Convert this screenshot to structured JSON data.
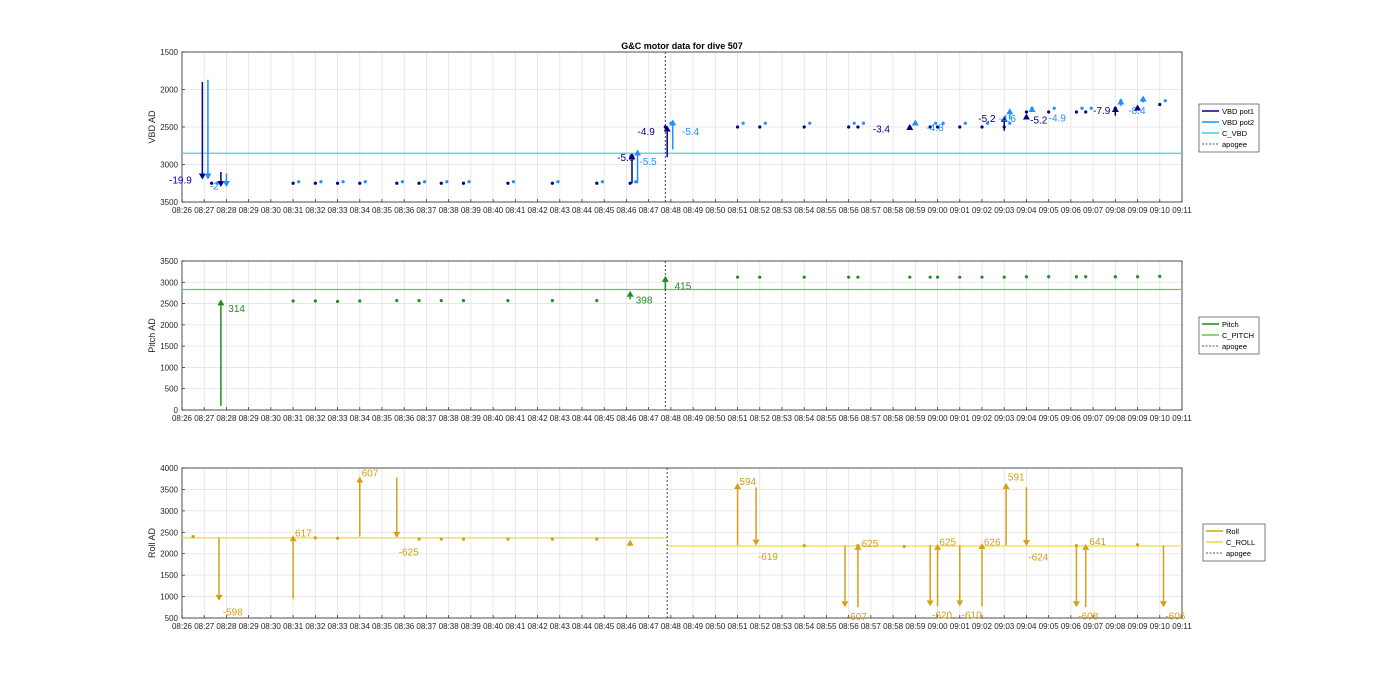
{
  "chart_data": [
    {
      "type": "scatter",
      "title": "G&C motor data for dive 507",
      "ylabel": "VBD AD",
      "y_reversed": true,
      "ylim": [
        1500,
        3500
      ],
      "yticks": [
        1500,
        2000,
        2500,
        3000,
        3500
      ],
      "xlim": [
        "08:26",
        "09:11"
      ],
      "grid": true,
      "legend": "right",
      "apogee": "08:47:45",
      "hlines": [
        {
          "name": "C_VBD",
          "y": 2850,
          "color": "#3cd6d6"
        }
      ],
      "series": [
        {
          "name": "VBD pot1",
          "color": "#00008b",
          "x": [
            "08:27:20",
            "08:31:00",
            "08:32:00",
            "08:33:00",
            "08:34:00",
            "08:35:40",
            "08:36:40",
            "08:37:40",
            "08:38:40",
            "08:40:40",
            "08:42:40",
            "08:44:40",
            "08:46:10",
            "08:47:45",
            "08:51:00",
            "08:52:00",
            "08:54:00",
            "08:56:00",
            "08:56:25",
            "08:58:45",
            "08:59:40",
            "09:00:00",
            "09:01:00",
            "09:02:00",
            "09:03:00",
            "09:04:00",
            "09:05:00",
            "09:06:15",
            "09:06:40",
            "09:08:00",
            "09:09:00",
            "09:10:00"
          ],
          "values": [
            3250,
            3250,
            3250,
            3250,
            3250,
            3250,
            3250,
            3250,
            3250,
            3250,
            3250,
            3250,
            3250,
            2500,
            2500,
            2500,
            2500,
            2500,
            2500,
            2500,
            2500,
            2500,
            2500,
            2500,
            2500,
            2300,
            2300,
            2300,
            2300,
            2250,
            2250,
            2200
          ]
        },
        {
          "name": "VBD pot2",
          "color": "#1e90ff",
          "x": [
            "08:27:35",
            "08:31:15",
            "08:32:15",
            "08:33:15",
            "08:34:15",
            "08:35:55",
            "08:36:55",
            "08:37:55",
            "08:38:55",
            "08:40:55",
            "08:42:55",
            "08:44:55",
            "08:46:25",
            "08:48:00",
            "08:51:15",
            "08:52:15",
            "08:54:15",
            "08:56:15",
            "08:56:40",
            "08:59:00",
            "08:59:55",
            "09:00:15",
            "09:01:15",
            "09:02:15",
            "09:03:15",
            "09:04:15",
            "09:05:15",
            "09:06:30",
            "09:06:55",
            "09:08:15",
            "09:09:15",
            "09:10:15"
          ],
          "values": [
            3250,
            3230,
            3230,
            3230,
            3230,
            3230,
            3230,
            3230,
            3230,
            3230,
            3230,
            3230,
            3230,
            2450,
            2450,
            2450,
            2450,
            2450,
            2450,
            2450,
            2450,
            2450,
            2450,
            2450,
            2450,
            2250,
            2250,
            2250,
            2250,
            2150,
            2150,
            2150
          ]
        },
        {
          "name": "C_VBD",
          "color": "#3cd6d6"
        },
        {
          "name": "apogee",
          "color": "#555555"
        }
      ],
      "arrows": [
        {
          "x": "08:26:55",
          "from": 1900,
          "to": 3200,
          "color": "#00008b",
          "label": "-19.9",
          "lx": "08:25:25",
          "ly": 3200
        },
        {
          "x": "08:27:10",
          "from": 1870,
          "to": 3200,
          "color": "#1e90ff",
          "label": "-2",
          "lx": "08:27:15",
          "ly": 3280
        },
        {
          "x": "08:27:45",
          "from": 3100,
          "to": 3300,
          "color": "#00008b"
        },
        {
          "x": "08:28:00",
          "from": 3120,
          "to": 3300,
          "color": "#1e90ff"
        },
        {
          "x": "08:46:15",
          "from": 3250,
          "to": 2850,
          "color": "#00008b",
          "label": "-5.0",
          "lx": "08:45:35",
          "ly": 2900
        },
        {
          "x": "08:46:30",
          "from": 3250,
          "to": 2800,
          "color": "#1e90ff",
          "label": "-5.5",
          "lx": "08:46:35",
          "ly": 2950
        },
        {
          "x": "08:47:50",
          "from": 2900,
          "to": 2480,
          "color": "#00008b",
          "label": "-4.9",
          "lx": "08:46:30",
          "ly": 2550
        },
        {
          "x": "08:48:05",
          "from": 2800,
          "to": 2400,
          "color": "#1e90ff",
          "label": "-5.4",
          "lx": "08:48:30",
          "ly": 2550
        },
        {
          "x": "08:58:45",
          "from": 2520,
          "to": 2460,
          "color": "#00008b",
          "label": "-3.4",
          "lx": "08:57:05",
          "ly": 2520
        },
        {
          "x": "08:59:00",
          "from": 2460,
          "to": 2400,
          "color": "#1e90ff",
          "label": "-4.8",
          "lx": "08:59:30",
          "ly": 2500
        },
        {
          "x": "09:03:00",
          "from": 2550,
          "to": 2350,
          "color": "#00008b",
          "label": "-5.2",
          "lx": "09:01:50",
          "ly": 2380
        },
        {
          "x": "09:03:15",
          "from": 2400,
          "to": 2250,
          "color": "#1e90ff",
          "label": "-4.6",
          "lx": "09:02:45",
          "ly": 2380
        },
        {
          "x": "09:04:00",
          "from": 2400,
          "to": 2320,
          "color": "#00008b",
          "label": "-5.2",
          "lx": "09:04:10",
          "ly": 2400
        },
        {
          "x": "09:04:15",
          "from": 2300,
          "to": 2220,
          "color": "#1e90ff",
          "label": "-4.9",
          "lx": "09:05:00",
          "ly": 2370
        },
        {
          "x": "09:08:00",
          "from": 2350,
          "to": 2220,
          "color": "#00008b",
          "label": "-7.9",
          "lx": "09:07:00",
          "ly": 2270
        },
        {
          "x": "09:08:15",
          "from": 2220,
          "to": 2120,
          "color": "#1e90ff",
          "label": "-8.4",
          "lx": "09:08:35",
          "ly": 2270
        },
        {
          "x": "09:09:00",
          "from": 2270,
          "to": 2200,
          "color": "#00008b"
        },
        {
          "x": "09:09:15",
          "from": 2170,
          "to": 2080,
          "color": "#1e90ff"
        }
      ]
    },
    {
      "type": "scatter",
      "ylabel": "Pitch AD",
      "ylim": [
        0,
        3500
      ],
      "yticks": [
        0,
        500,
        1000,
        1500,
        2000,
        2500,
        3000,
        3500
      ],
      "xlim": [
        "08:26",
        "09:11"
      ],
      "grid": true,
      "legend": "right",
      "apogee": "08:47:45",
      "hlines": [
        {
          "name": "C_PITCH",
          "y": 2830,
          "color": "#66cc44"
        }
      ],
      "series": [
        {
          "name": "Pitch",
          "color": "#228b22",
          "x": [
            "08:31:00",
            "08:32:00",
            "08:33:00",
            "08:34:00",
            "08:35:40",
            "08:36:40",
            "08:37:40",
            "08:38:40",
            "08:40:40",
            "08:42:40",
            "08:44:40",
            "08:51:00",
            "08:52:00",
            "08:54:00",
            "08:56:00",
            "08:56:25",
            "08:58:45",
            "08:59:40",
            "09:00:00",
            "09:01:00",
            "09:02:00",
            "09:03:00",
            "09:04:00",
            "09:05:00",
            "09:06:15",
            "09:06:40",
            "09:08:00",
            "09:09:00",
            "09:10:00"
          ],
          "values": [
            2560,
            2560,
            2550,
            2560,
            2570,
            2570,
            2570,
            2570,
            2570,
            2570,
            2570,
            3120,
            3120,
            3120,
            3120,
            3120,
            3120,
            3120,
            3120,
            3120,
            3120,
            3120,
            3130,
            3130,
            3130,
            3130,
            3130,
            3130,
            3140
          ]
        },
        {
          "name": "C_PITCH",
          "color": "#66cc44"
        },
        {
          "name": "apogee",
          "color": "#555555"
        }
      ],
      "arrows": [
        {
          "x": "08:27:45",
          "from": 100,
          "to": 2600,
          "color": "#228b22",
          "label": "314",
          "lx": "08:28:05",
          "ly": 2400
        },
        {
          "x": "08:46:10",
          "from": 2600,
          "to": 2800,
          "color": "#228b22",
          "label": "398",
          "lx": "08:46:25",
          "ly": 2600
        },
        {
          "x": "08:47:45",
          "from": 2800,
          "to": 3150,
          "color": "#228b22",
          "label": "415",
          "lx": "08:48:10",
          "ly": 2920
        }
      ]
    },
    {
      "type": "scatter",
      "ylabel": "Roll AD",
      "ylim": [
        500,
        4000
      ],
      "yticks": [
        500,
        1000,
        1500,
        2000,
        2500,
        3000,
        3500,
        4000
      ],
      "xlim": [
        "08:26",
        "09:11"
      ],
      "xticks": [
        "08:26",
        "08:27",
        "08:28",
        "08:29",
        "08:30",
        "08:31",
        "08:32",
        "08:33",
        "08:34",
        "08:35",
        "08:36",
        "08:37",
        "08:38",
        "08:39",
        "08:40",
        "08:41",
        "08:42",
        "08:43",
        "08:44",
        "08:45",
        "08:46",
        "08:47",
        "08:48",
        "08:49",
        "08:50",
        "08:51",
        "08:52",
        "08:53",
        "08:54",
        "08:55",
        "08:56",
        "08:57",
        "08:58",
        "08:59",
        "09:00",
        "09:01",
        "09:02",
        "09:03",
        "09:04",
        "09:05",
        "09:06",
        "09:07",
        "09:08",
        "09:09",
        "09:10",
        "09:11"
      ],
      "grid": true,
      "legend": "right",
      "apogee": "08:47:50",
      "hlines": [
        {
          "name": "C_ROLL",
          "y": 2370,
          "color": "#ecd94a",
          "x": [
            "08:26",
            "08:47:50"
          ]
        },
        {
          "name": "C_ROLL",
          "y": 2180,
          "color": "#ecd94a",
          "x": [
            "08:47:50",
            "09:11"
          ]
        }
      ],
      "series": [
        {
          "name": "Roll",
          "color": "#d4a017",
          "x": [
            "08:26:30",
            "08:32:00",
            "08:33:00",
            "08:36:40",
            "08:37:40",
            "08:38:40",
            "08:40:40",
            "08:42:40",
            "08:44:40",
            "08:54:00",
            "08:56:25",
            "08:58:30",
            "09:06:15",
            "09:09:00"
          ],
          "values": [
            2400,
            2370,
            2360,
            2340,
            2340,
            2340,
            2340,
            2340,
            2340,
            2190,
            2190,
            2170,
            2190,
            2210
          ]
        },
        {
          "name": "C_ROLL",
          "color": "#ecd94a"
        },
        {
          "name": "apogee",
          "color": "#555555"
        }
      ],
      "arrows": [
        {
          "x": "08:27:40",
          "from": 2380,
          "to": 900,
          "color": "#d4a017",
          "label": "-598",
          "lx": "08:27:50",
          "ly": 650
        },
        {
          "x": "08:31:00",
          "from": 950,
          "to": 2430,
          "color": "#d4a017",
          "label": "617",
          "lx": "08:31:05",
          "ly": 2500
        },
        {
          "x": "08:34:00",
          "from": 2400,
          "to": 3800,
          "color": "#d4a017",
          "label": "607",
          "lx": "08:34:05",
          "ly": 3900
        },
        {
          "x": "08:35:40",
          "from": 3780,
          "to": 2370,
          "color": "#d4a017",
          "label": "-625",
          "lx": "08:35:45",
          "ly": 2050
        },
        {
          "x": "08:46:10",
          "from": 2180,
          "to": 2330,
          "color": "#d4a017"
        },
        {
          "x": "08:51:00",
          "from": 2200,
          "to": 3650,
          "color": "#d4a017",
          "label": "594",
          "lx": "08:51:05",
          "ly": 3700
        },
        {
          "x": "08:51:50",
          "from": 3550,
          "to": 2190,
          "color": "#d4a017",
          "label": "-619",
          "lx": "08:51:55",
          "ly": 1950
        },
        {
          "x": "08:55:50",
          "from": 2190,
          "to": 750,
          "color": "#d4a017",
          "label": "-607",
          "lx": "08:55:55",
          "ly": 550
        },
        {
          "x": "08:56:25",
          "from": 750,
          "to": 2230,
          "color": "#d4a017",
          "label": "625",
          "lx": "08:56:35",
          "ly": 2250
        },
        {
          "x": "08:59:40",
          "from": 2200,
          "to": 770,
          "color": "#d4a017",
          "label": "-620",
          "lx": "08:59:45",
          "ly": 580
        },
        {
          "x": "09:00:00",
          "from": 770,
          "to": 2230,
          "color": "#d4a017",
          "label": "625",
          "lx": "09:00:05",
          "ly": 2280
        },
        {
          "x": "09:01:00",
          "from": 2200,
          "to": 770,
          "color": "#d4a017",
          "label": "-610",
          "lx": "09:01:05",
          "ly": 580
        },
        {
          "x": "09:02:00",
          "from": 770,
          "to": 2250,
          "color": "#d4a017",
          "label": "626",
          "lx": "09:02:05",
          "ly": 2280
        },
        {
          "x": "09:03:05",
          "from": 2200,
          "to": 3650,
          "color": "#d4a017",
          "label": "591",
          "lx": "09:03:10",
          "ly": 3800
        },
        {
          "x": "09:04:00",
          "from": 3550,
          "to": 2180,
          "color": "#d4a017",
          "label": "-624",
          "lx": "09:04:05",
          "ly": 1930
        },
        {
          "x": "09:06:15",
          "from": 2180,
          "to": 750,
          "color": "#d4a017",
          "label": "-608",
          "lx": "09:06:20",
          "ly": 560
        },
        {
          "x": "09:06:40",
          "from": 750,
          "to": 2230,
          "color": "#d4a017",
          "label": "641",
          "lx": "09:06:50",
          "ly": 2300
        },
        {
          "x": "09:10:10",
          "from": 2180,
          "to": 750,
          "color": "#d4a017",
          "label": "-606",
          "lx": "09:10:15",
          "ly": 560
        }
      ]
    }
  ]
}
